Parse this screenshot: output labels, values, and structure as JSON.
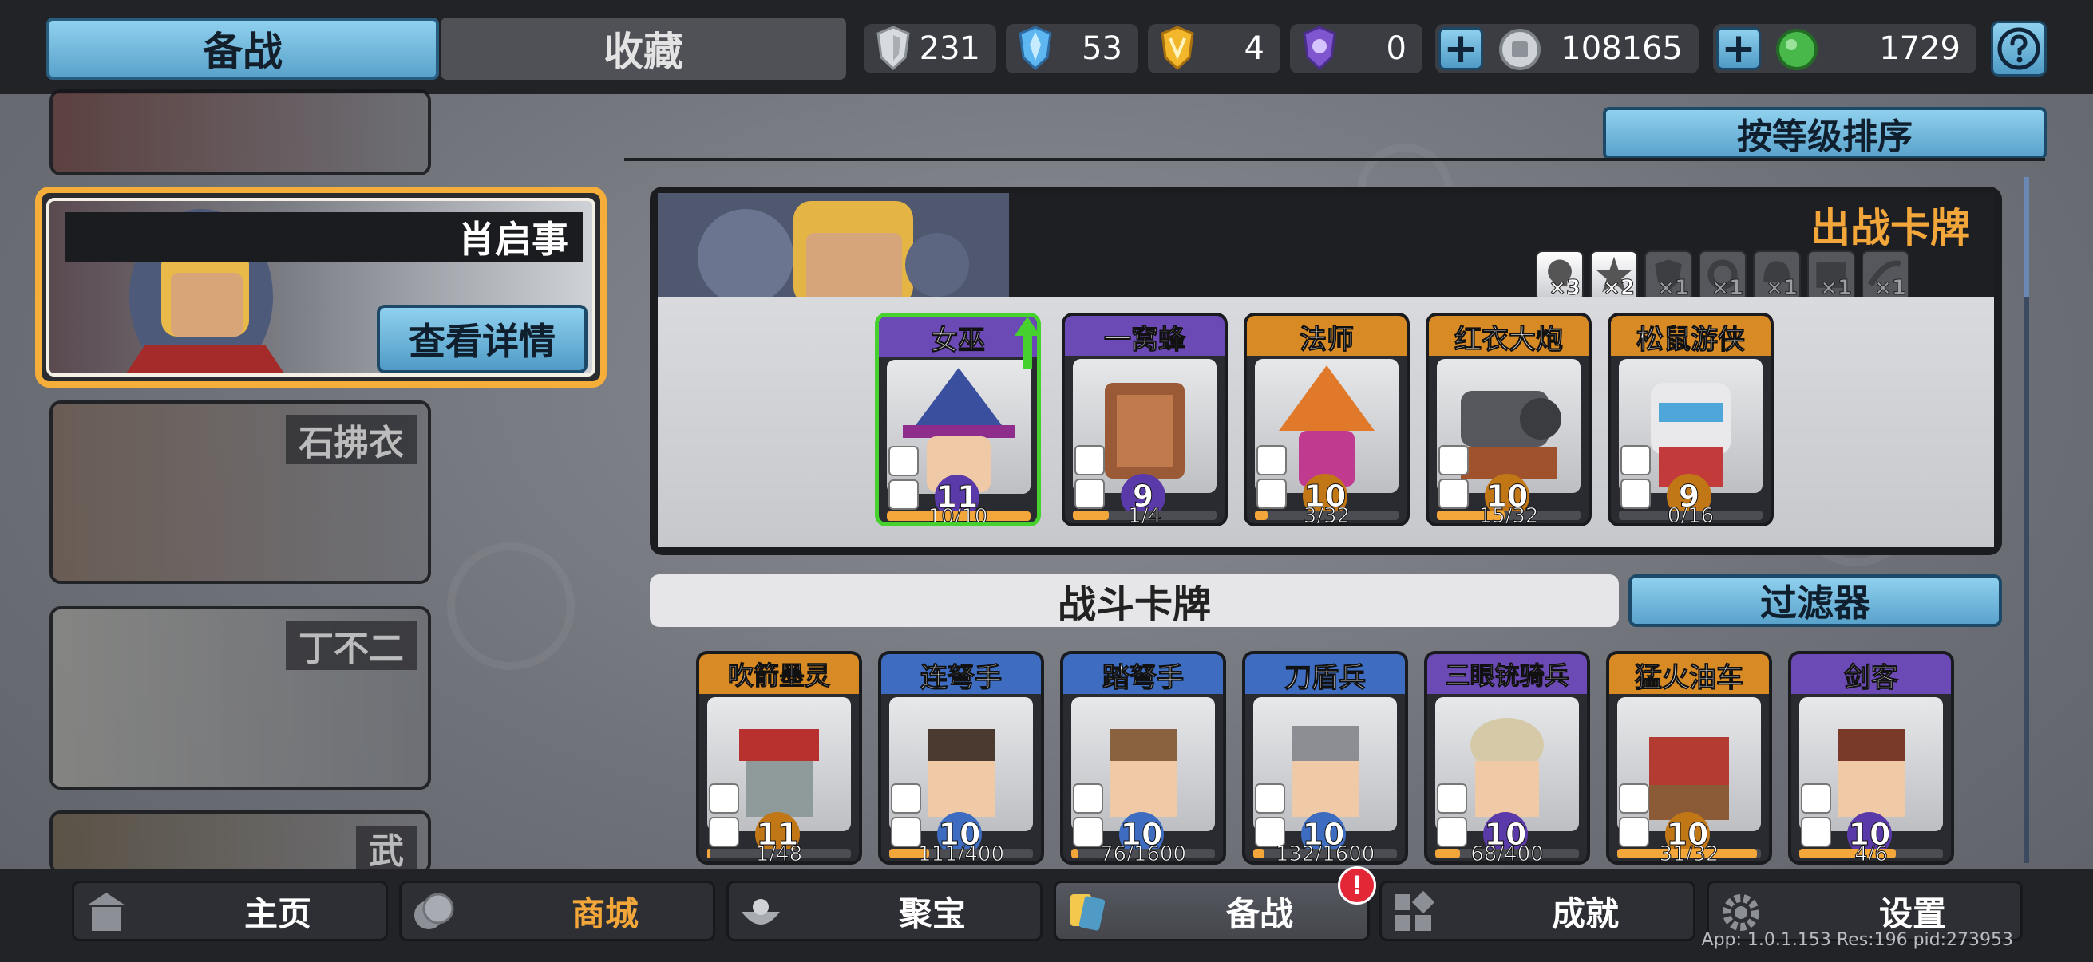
{
  "header": {
    "tabs": [
      {
        "label": "备战",
        "active": true
      },
      {
        "label": "收藏",
        "active": false
      }
    ],
    "resources": [
      {
        "icon": "silver-shield-icon",
        "value": "231"
      },
      {
        "icon": "crystal-shield-icon",
        "value": "53"
      },
      {
        "icon": "gold-shield-icon",
        "value": "4"
      },
      {
        "icon": "purple-shield-icon",
        "value": "0"
      },
      {
        "icon": "silver-coin-icon",
        "value": "108165"
      },
      {
        "icon": "green-gem-icon",
        "value": "1729"
      }
    ],
    "help_icon": "question-mark-icon"
  },
  "heroes": {
    "selected": {
      "name": "肖启事",
      "details_label": "查看详情"
    },
    "others": [
      "石拂衣",
      "丁不二",
      "武"
    ]
  },
  "sort_label": "按等级排序",
  "deck": {
    "title": "出战卡牌",
    "traits": [
      {
        "icon": "skull-trait-icon",
        "count": "×3",
        "active": true
      },
      {
        "icon": "burst-trait-icon",
        "count": "×2",
        "active": true
      },
      {
        "icon": "shield-trait-icon",
        "count": "×1",
        "active": false
      },
      {
        "icon": "gear-trait-icon",
        "count": "×1",
        "active": false
      },
      {
        "icon": "helmet-trait-icon",
        "count": "×1",
        "active": false
      },
      {
        "icon": "wall-trait-icon",
        "count": "×1",
        "active": false
      },
      {
        "icon": "wind-trait-icon",
        "count": "×1",
        "active": false
      }
    ],
    "cards": [
      {
        "name": "女巫",
        "level": "11",
        "progress": "10/10",
        "fraction": 1.0,
        "rarity": "purple",
        "selected": true,
        "upgradable": true
      },
      {
        "name": "一窝蜂",
        "level": "9",
        "progress": "1/4",
        "fraction": 0.25,
        "rarity": "purple",
        "selected": false
      },
      {
        "name": "法师",
        "level": "10",
        "progress": "3/32",
        "fraction": 0.09,
        "rarity": "orange",
        "selected": false
      },
      {
        "name": "红衣大炮",
        "level": "10",
        "progress": "15/32",
        "fraction": 0.47,
        "rarity": "orange",
        "selected": false
      },
      {
        "name": "松鼠游侠",
        "level": "9",
        "progress": "0/16",
        "fraction": 0.0,
        "rarity": "orange",
        "selected": false
      }
    ]
  },
  "fight_cards": {
    "title": "战斗卡牌",
    "filter_label": "过滤器",
    "cards": [
      {
        "name": "吹箭墨灵",
        "level": "11",
        "progress": "1/48",
        "fraction": 0.02,
        "rarity": "orange"
      },
      {
        "name": "连弩手",
        "level": "10",
        "progress": "111/400",
        "fraction": 0.28,
        "rarity": "blue"
      },
      {
        "name": "踏弩手",
        "level": "10",
        "progress": "76/1600",
        "fraction": 0.05,
        "rarity": "blue"
      },
      {
        "name": "刀盾兵",
        "level": "10",
        "progress": "132/1600",
        "fraction": 0.08,
        "rarity": "blue"
      },
      {
        "name": "三眼铳骑兵",
        "level": "10",
        "progress": "68/400",
        "fraction": 0.17,
        "rarity": "purple"
      },
      {
        "name": "猛火油车",
        "level": "10",
        "progress": "31/32",
        "fraction": 0.97,
        "rarity": "orange"
      },
      {
        "name": "剑客",
        "level": "10",
        "progress": "4/6",
        "fraction": 0.67,
        "rarity": "purple"
      }
    ]
  },
  "nav": {
    "items": [
      {
        "label": "主页",
        "icon": "pagoda-icon",
        "active": false,
        "color": "#ffffff"
      },
      {
        "label": "商城",
        "icon": "coins-icon",
        "active": false,
        "color": "#f3a63a"
      },
      {
        "label": "聚宝",
        "icon": "treasure-bowl-icon",
        "active": false,
        "color": "#ffffff"
      },
      {
        "label": "备战",
        "icon": "cards-icon",
        "active": true,
        "color": "#ffffff"
      },
      {
        "label": "成就",
        "icon": "achievement-grid-icon",
        "active": false,
        "color": "#ffffff"
      },
      {
        "label": "设置",
        "icon": "gear-icon",
        "active": false,
        "color": "#ffffff"
      }
    ],
    "badge": "!"
  },
  "version_text": "App: 1.0.1.153 Res:196 pid:273953",
  "colors": {
    "accent_blue": "#5aa3cc",
    "accent_orange": "#f3a63a",
    "selected_green": "#47d12e",
    "badge_red": "#e42736"
  }
}
